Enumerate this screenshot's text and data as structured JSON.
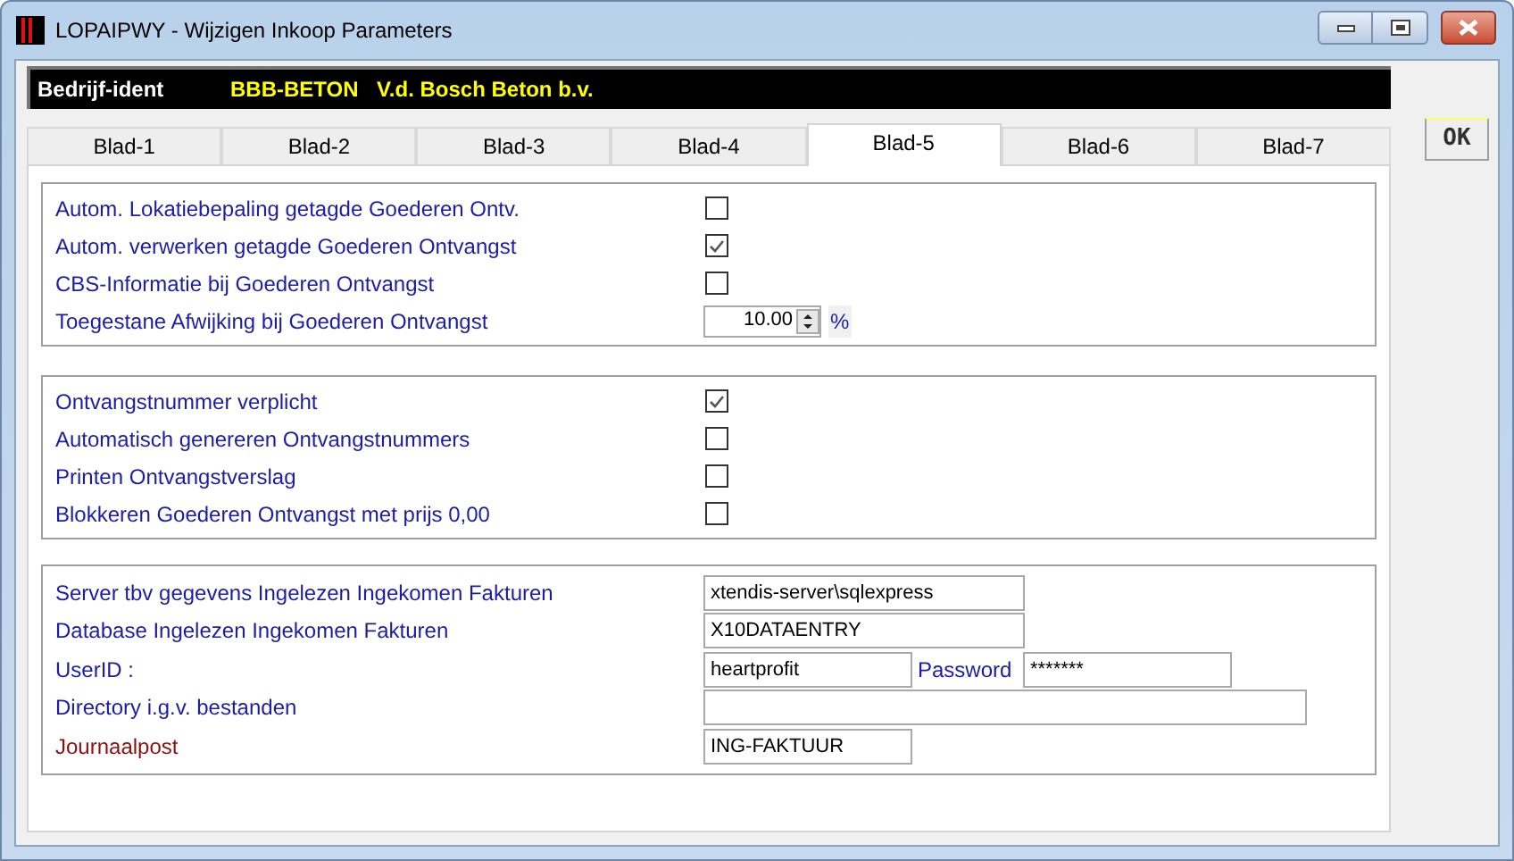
{
  "window": {
    "title": "LOPAIPWY - Wijzigen Inkoop Parameters"
  },
  "company": {
    "label": "Bedrijf-ident",
    "code": "BBB-BETON",
    "name": "V.d. Bosch Beton b.v."
  },
  "tabs": [
    {
      "label": "Blad-1",
      "selected": false
    },
    {
      "label": "Blad-2",
      "selected": false
    },
    {
      "label": "Blad-3",
      "selected": false
    },
    {
      "label": "Blad-4",
      "selected": false
    },
    {
      "label": "Blad-5",
      "selected": true
    },
    {
      "label": "Blad-6",
      "selected": false
    },
    {
      "label": "Blad-7",
      "selected": false
    }
  ],
  "ok_button": "OK",
  "sections": [
    {
      "rows": [
        {
          "kind": "checkbox",
          "label": "Autom. Lokatiebepaling getagde Goederen Ontv.",
          "checked": false
        },
        {
          "kind": "checkbox",
          "label": "Autom. verwerken getagde Goederen Ontvangst",
          "checked": true
        },
        {
          "kind": "checkbox",
          "label": "CBS-Informatie bij Goederen Ontvangst",
          "checked": false
        },
        {
          "kind": "spinner",
          "label": "Toegestane Afwijking bij Goederen Ontvangst",
          "value": "10.00",
          "unit": "%"
        }
      ]
    },
    {
      "rows": [
        {
          "kind": "checkbox",
          "label": "Ontvangstnummer verplicht",
          "checked": true
        },
        {
          "kind": "checkbox",
          "label": "Automatisch genereren Ontvangstnummers",
          "checked": false
        },
        {
          "kind": "checkbox",
          "label": "Printen Ontvangstverslag",
          "checked": false
        },
        {
          "kind": "checkbox",
          "label": "Blokkeren Goederen Ontvangst met prijs 0,00",
          "checked": false
        }
      ]
    },
    {
      "rows": [
        {
          "kind": "text",
          "label": "Server tbv gegevens Ingelezen Ingekomen Fakturen",
          "value": "xtendis-server\\sqlexpress",
          "color": "#1c1ca8"
        },
        {
          "kind": "text",
          "label": "Database Ingelezen Ingekomen Fakturen",
          "value": "X10DATAENTRY",
          "color": "#1c1ca8"
        },
        {
          "kind": "credentials",
          "label": "UserID :",
          "value": "heartprofit",
          "label2": "Password",
          "value2": "*******",
          "color": "#1c1ca8"
        },
        {
          "kind": "path",
          "label": "Directory i.g.v. bestanden",
          "value": "",
          "color": "#1c1ca8"
        },
        {
          "kind": "code",
          "label": "Journaalpost",
          "value": "ING-FAKTUUR",
          "color": "#8b1010"
        }
      ]
    }
  ]
}
